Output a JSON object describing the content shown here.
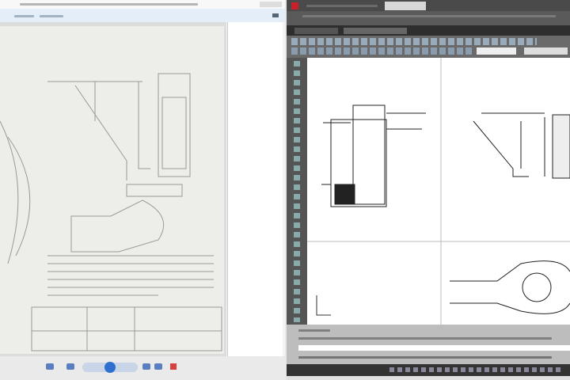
{
  "colors": {
    "viewer_bg": "#d8d8d8",
    "cad_bg": "#3c3c3c",
    "cad_canvas": "#ffffff",
    "accent": "#3a78d8",
    "cad_logo": "#c8202a"
  },
  "viewer": {
    "page_label": "",
    "zoom": ""
  },
  "cad": {
    "command_line": "",
    "status": ""
  }
}
